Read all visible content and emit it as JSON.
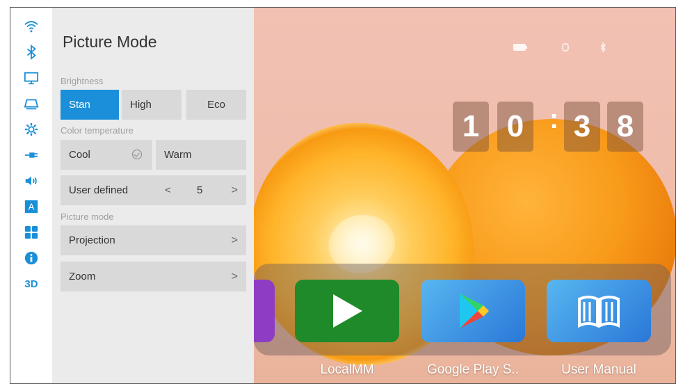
{
  "panel": {
    "title": "Picture Mode",
    "brightness": {
      "label": "Brightness",
      "options": [
        "Stan",
        "High",
        "Eco"
      ],
      "selected": "Stan"
    },
    "color_temperature": {
      "label": "Color temperature",
      "options": [
        "Cool",
        "Warm"
      ],
      "selected": "Cool"
    },
    "user_defined": {
      "label": "User defined",
      "prev": "<",
      "value": "5",
      "next": ">"
    },
    "picture_mode": {
      "label": "Picture mode",
      "items": [
        {
          "label": "Projection",
          "chevron": ">"
        },
        {
          "label": "Zoom",
          "chevron": ">"
        }
      ]
    }
  },
  "rail": {
    "icons": [
      "wifi-icon",
      "bluetooth-icon",
      "monitor-icon",
      "projector-icon",
      "settings-gear-icon",
      "input-plug-icon",
      "volume-icon",
      "language-a-icon",
      "apps-grid-icon",
      "info-icon",
      "3d-icon"
    ],
    "three_d_label": "3D",
    "a_label": "A"
  },
  "clock": {
    "digits": [
      "1",
      "0",
      "3",
      "8"
    ],
    "separator": ":"
  },
  "dock": {
    "apps": [
      {
        "label": "LocalMM",
        "color": "#1f8a2a",
        "icon": "play-icon"
      },
      {
        "label": "Google Play S..",
        "color": "#3a8ee6",
        "icon": "google-play-icon"
      },
      {
        "label": "User Manual",
        "color": "#3a8ee6",
        "icon": "book-icon"
      }
    ],
    "partial_tile_color": "#8e3cc4"
  },
  "colors": {
    "accent": "#1b8fd9",
    "panel_bg": "#ebebeb"
  }
}
